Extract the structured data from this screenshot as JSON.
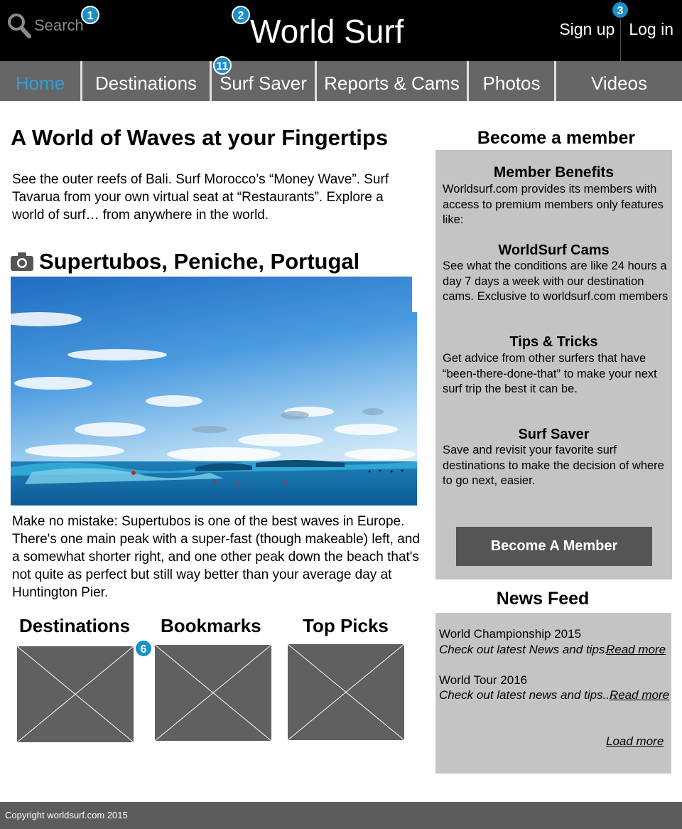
{
  "header": {
    "search_label": "Search",
    "site_title": "World Surf",
    "sign_up": "Sign up",
    "log_in": "Log in"
  },
  "badges": [
    "1",
    "2",
    "3",
    "11",
    "6"
  ],
  "nav": {
    "items": [
      {
        "label": "Home"
      },
      {
        "label": "Destinations"
      },
      {
        "label": "Surf Saver"
      },
      {
        "label": "Reports & Cams"
      },
      {
        "label": "Photos"
      },
      {
        "label": "Videos"
      }
    ]
  },
  "main": {
    "title": "A World of Waves at your Fingertips",
    "intro": "See the outer reefs of Bali. Surf Morocco’s “Money Wave”. Surf Tavarua from your own virtual seat at “Restaurants”. Explore a world of surf… from anywhere in the world.",
    "photo_title": "Supertubos, Peniche, Portugal",
    "description": "Make no mistake: Supertubos is one of the best waves in Europe. There's one main peak with a super-fast (though makeable) left, and a somewhat shorter right, and one other peak down the beach that's not quite as perfect but still way better than your average day at Huntington Pier.",
    "categories": [
      {
        "label": "Destinations"
      },
      {
        "label": "Bookmarks"
      },
      {
        "label": "Top Picks"
      }
    ]
  },
  "sidebar": {
    "member_heading": "Become a member",
    "benefits_title": "Member Benefits",
    "benefits_intro": "Worldsurf.com provides its members with access to premium members only features like:",
    "benefits": [
      {
        "title": "WorldSurf Cams",
        "text": "See what the conditions are like 24 hours a day 7 days a week with our destination cams. Exclusive to worldsurf.com members"
      },
      {
        "title": "Tips & Tricks",
        "text": "Get advice from other surfers that have “been-there-done-that” to make your next surf trip the best it can be."
      },
      {
        "title": "Surf Saver",
        "text": "Save and revisit your favorite surf destinations to make the decision of where to go next, easier."
      }
    ],
    "member_button": "Become A Member",
    "news_heading": "News Feed",
    "news": [
      {
        "title": "World Championship 2015",
        "teaser": "Check out latest News and tips...",
        "link": "Read more"
      },
      {
        "title": "World Tour 2016",
        "teaser": "Check out latest news and tips....",
        "link": "Read more"
      }
    ],
    "load_more": "Load more"
  },
  "footer": {
    "copyright": "Copyright worldsurf.com 2015"
  },
  "colors": {
    "header_bg": "#000000",
    "nav_bg": "#666666",
    "nav_active": "#2f9fd8",
    "badge": "#1a8fc8",
    "panel_bg": "#c4c4c4",
    "button_bg": "#555555",
    "placeholder": "#625f60",
    "footer_bg": "#5c5c5c"
  }
}
